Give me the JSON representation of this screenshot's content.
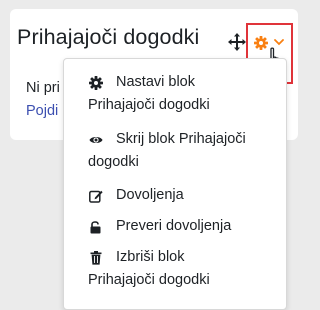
{
  "block": {
    "title": "Prihajajoči dogodki",
    "body_line1": "Ni pri",
    "body_line2": "Pojdi"
  },
  "menu": {
    "items": [
      {
        "label_line1": "Nastavi blok",
        "label_line2": "Prihajajoči dogodki",
        "icon": "gear-icon"
      },
      {
        "label_line1": "Skrij blok Prihajajoči",
        "label_line2": "dogodki",
        "icon": "eye-icon"
      },
      {
        "label_line1": "Dovoljenja",
        "label_line2": "",
        "icon": "edit-icon"
      },
      {
        "label_line1": "Preveri dovoljenja",
        "label_line2": "",
        "icon": "unlock-icon"
      },
      {
        "label_line1": "Izbriši blok",
        "label_line2": "Prihajajoči dogodki",
        "icon": "trash-icon"
      }
    ]
  },
  "colors": {
    "accent_orange": "#f98012",
    "highlight_red": "#e0343a",
    "link_blue": "#3c4fb0"
  }
}
